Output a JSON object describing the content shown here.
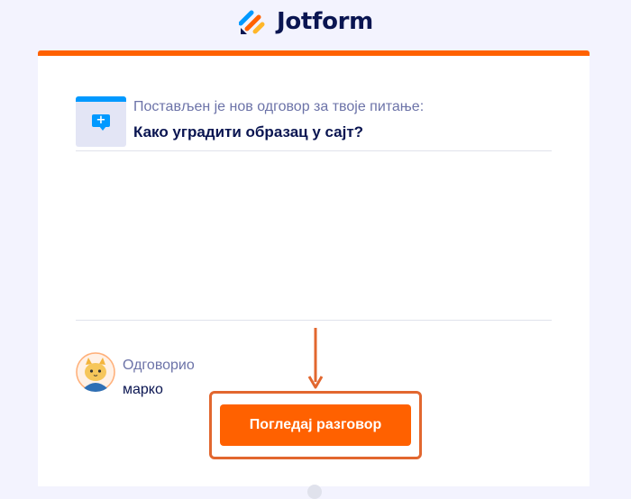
{
  "header": {
    "brand_name": "Jotform",
    "logo_icon": "jotform-logo-icon"
  },
  "colors": {
    "accent": "#ff6100",
    "navy": "#0a1551",
    "muted": "#6c73a8",
    "blue": "#0099ff",
    "highlight_frame": "#e2672f"
  },
  "question": {
    "icon": "chat-bubble-plus-icon",
    "subtitle": "Постављен је нов одговор за твоје питање:",
    "title": "Како уградити образац у сајт?"
  },
  "answer": {
    "avatar_icon": "cat-avatar-icon",
    "label": "Одговорио",
    "name": "марко"
  },
  "cta": {
    "label": "Погледај разговор",
    "pointer_icon": "down-arrow-icon"
  }
}
